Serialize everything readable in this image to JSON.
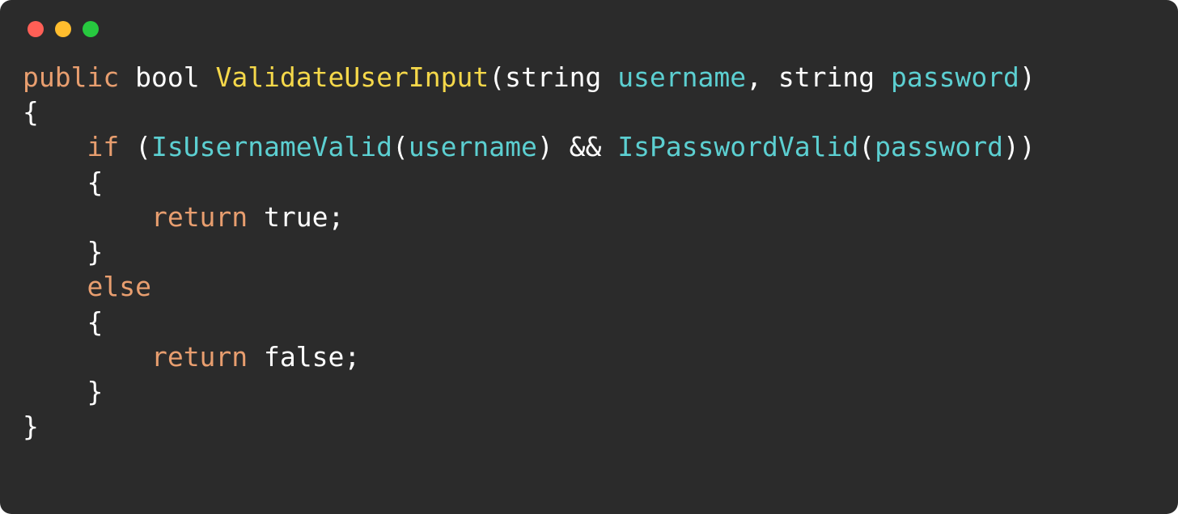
{
  "window": {
    "traffic_dots": [
      "red",
      "yellow",
      "green"
    ]
  },
  "code": {
    "lines": {
      "l1": {
        "public": "public",
        "bool": "bool",
        "fn": "ValidateUserInput",
        "lp": "(",
        "t1": "string",
        "p1": "username",
        "comma": ",",
        "t2": "string",
        "p2": "password",
        "rp": ")"
      },
      "l2": "{",
      "l3": {
        "if": "if",
        "lp": "(",
        "c1": "IsUsernameValid",
        "lp1": "(",
        "a1": "username",
        "rp1": ")",
        "and": "&&",
        "c2": "IsPasswordValid",
        "lp2": "(",
        "a2": "password",
        "rp2": ")",
        "rp": ")"
      },
      "l4": "{",
      "l5": {
        "ret": "return",
        "val": "true",
        "semi": ";"
      },
      "l6": "}",
      "l7": "else",
      "l8": "{",
      "l9": {
        "ret": "return",
        "val": "false",
        "semi": ";"
      },
      "l10": "}",
      "l11": "}"
    }
  }
}
